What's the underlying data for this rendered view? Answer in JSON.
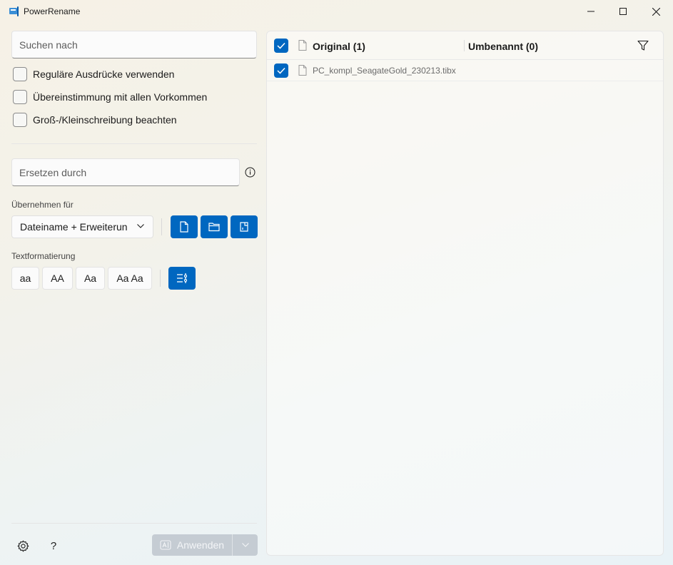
{
  "window": {
    "title": "PowerRename"
  },
  "search": {
    "placeholder": "Suchen nach"
  },
  "options": [
    {
      "label": "Reguläre Ausdrücke verwenden",
      "checked": false
    },
    {
      "label": "Übereinstimmung mit allen Vorkommen",
      "checked": false
    },
    {
      "label": "Groß-/Kleinschreibung beachten",
      "checked": false
    }
  ],
  "replace": {
    "placeholder": "Ersetzen durch"
  },
  "apply_to": {
    "label": "Übernehmen für",
    "selected": "Dateiname + Erweiterun",
    "buttons": [
      "file-icon",
      "folder-icon",
      "subfolder-icon"
    ]
  },
  "text_format": {
    "label": "Textformatierung",
    "buttons": [
      "aa",
      "AA",
      "Aa",
      "Aa Aa"
    ],
    "enumerate_icon": "enumerate-icon"
  },
  "footer": {
    "settings_icon": "gear-icon",
    "help_text": "?",
    "apply_label": "Anwenden"
  },
  "file_list": {
    "col_original": "Original (1)",
    "col_renamed": "Umbenannt (0)",
    "files": [
      {
        "name": "PC_kompl_SeagateGold_230213.tibx",
        "checked": true
      }
    ]
  },
  "colors": {
    "accent": "#0067c0",
    "disabled": "#c5ccd3"
  }
}
